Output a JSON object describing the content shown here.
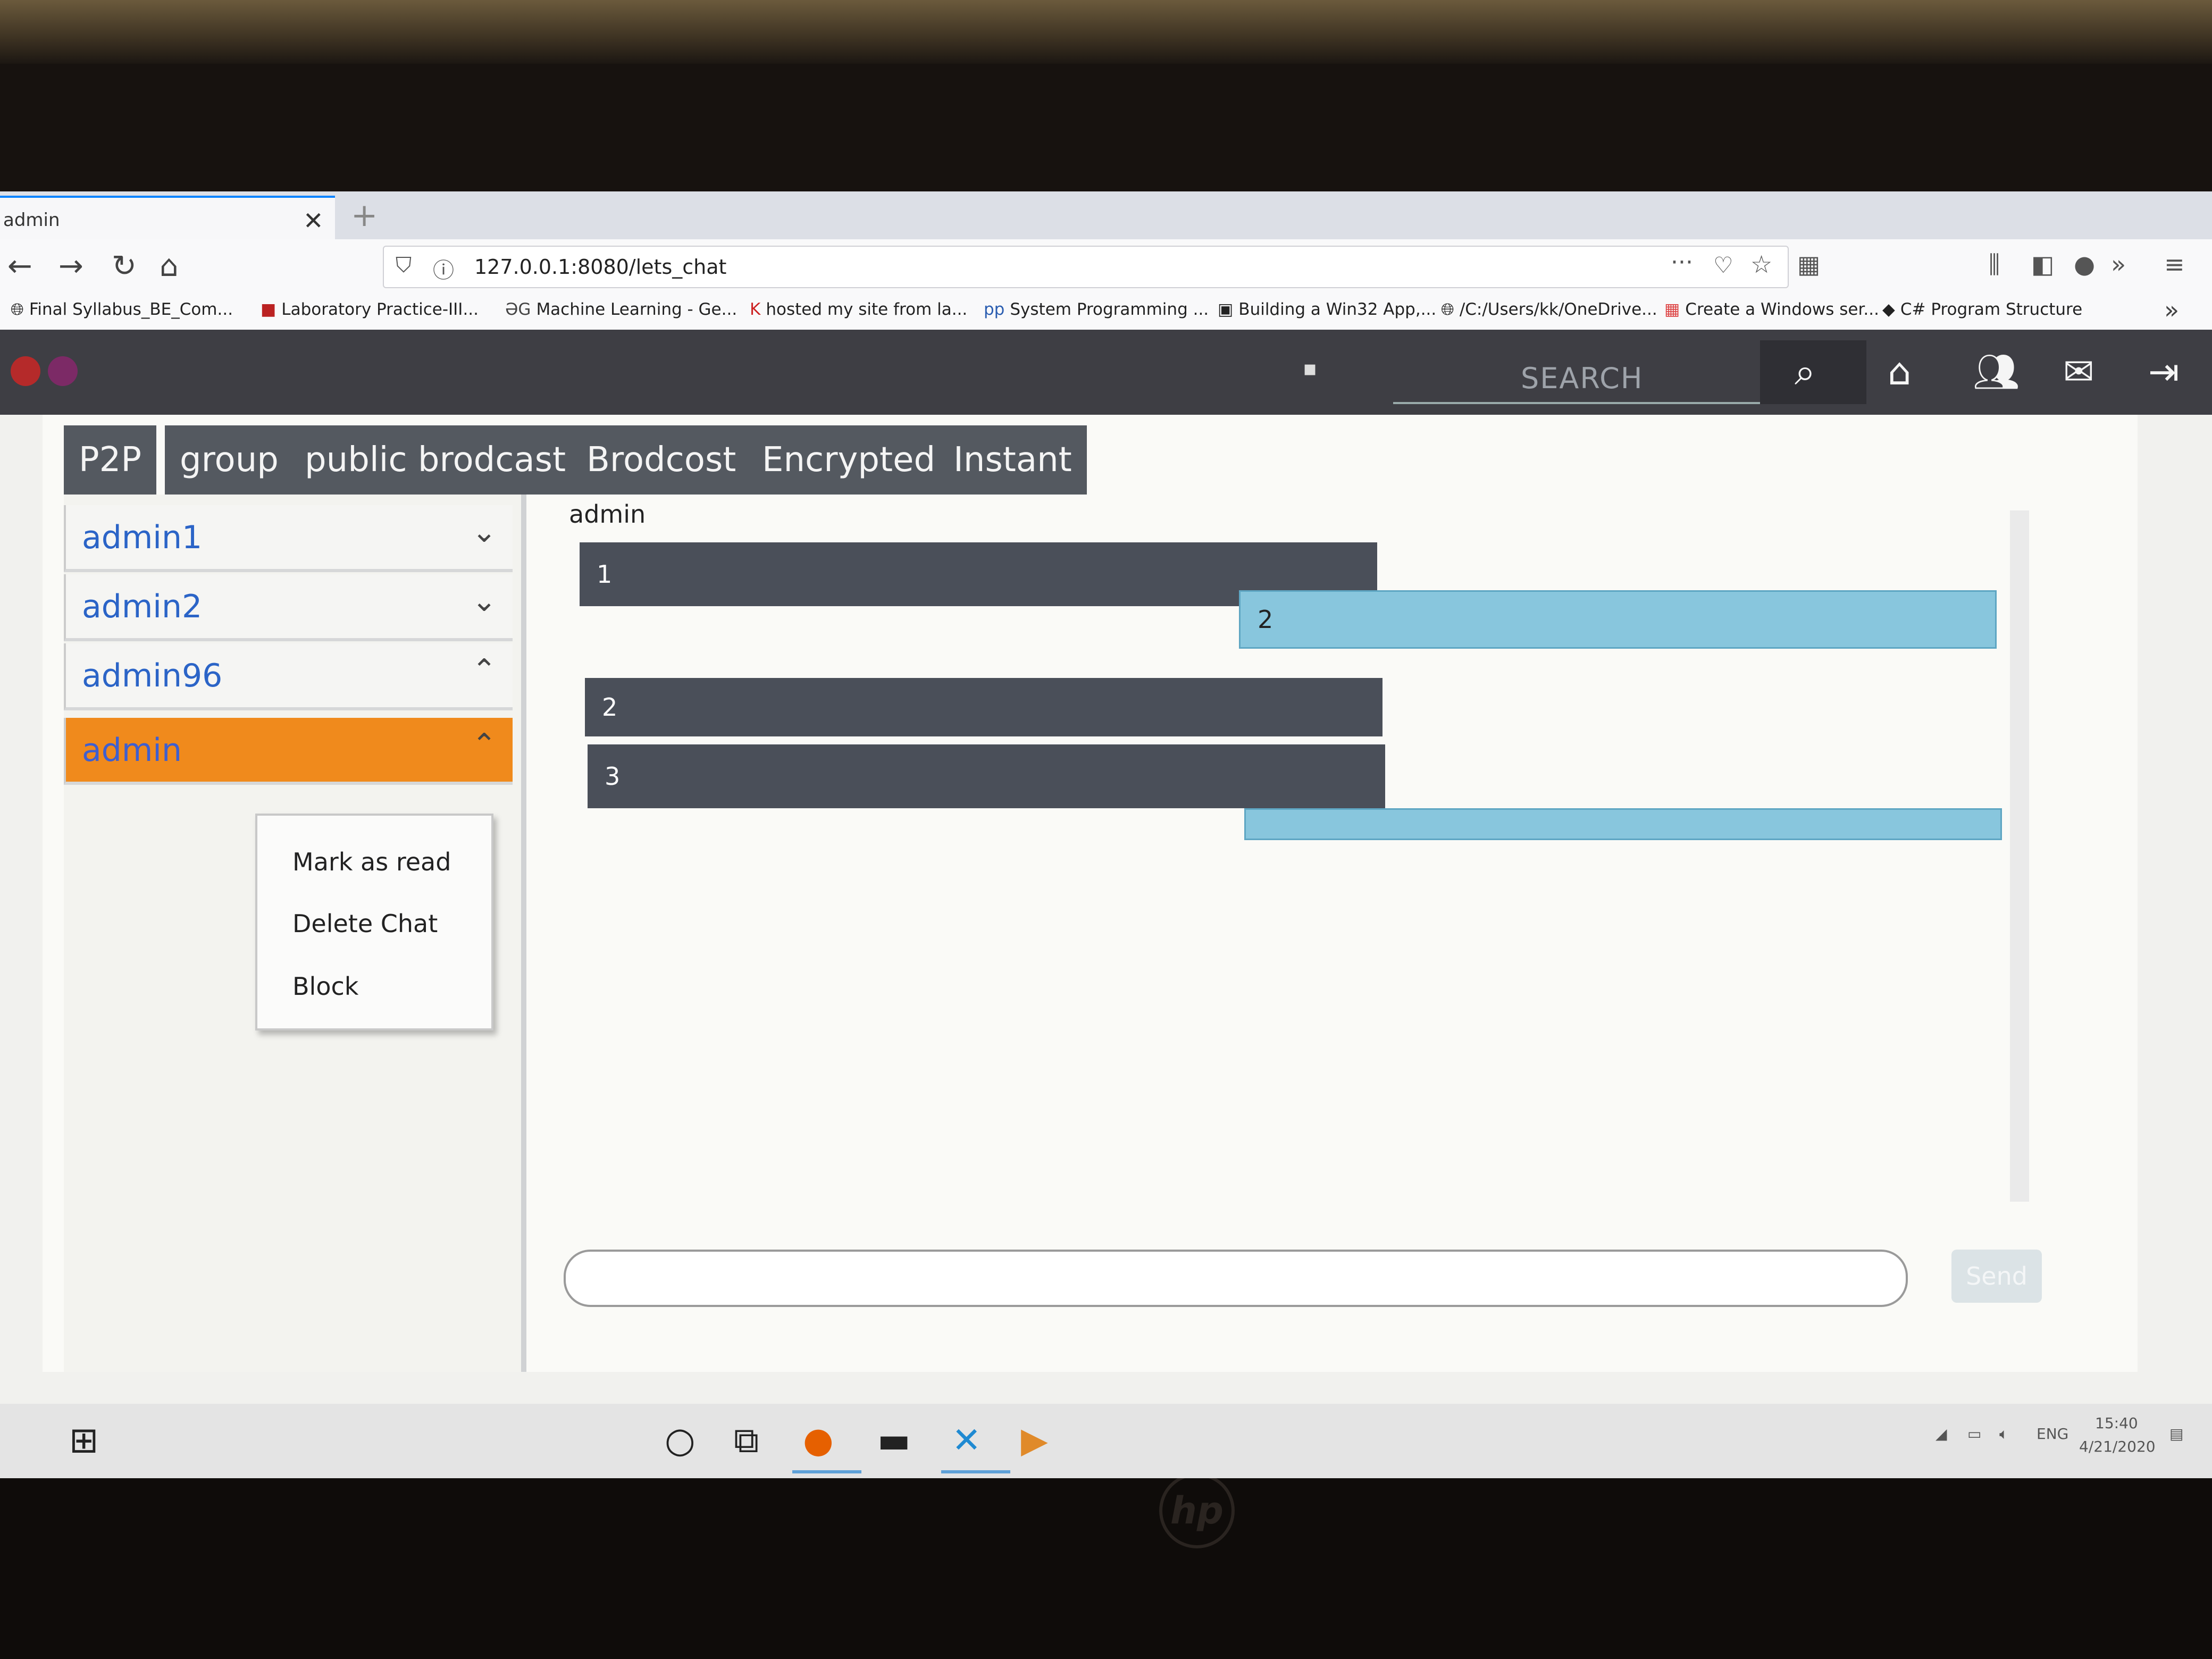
{
  "browser": {
    "tab_title": "admin",
    "tab_close": "✕",
    "new_tab": "+",
    "url": "127.0.0.1:8080/lets_chat",
    "bookmarks": [
      "Final Syllabus_BE_Com...",
      "Laboratory Practice-III...",
      "Machine Learning - Ge...",
      "hosted my site from la...",
      "System Programming ...",
      "Building a Win32 App,...",
      "/C:/Users/kk/OneDrive...",
      "Create a Windows ser...",
      "C# Program Structure"
    ]
  },
  "header": {
    "search_placeholder": "SEARCH"
  },
  "tabs": [
    {
      "label": "P2P"
    },
    {
      "label": "group"
    },
    {
      "label": "public brodcast"
    },
    {
      "label": "Brodcost"
    },
    {
      "label": "Encrypted"
    },
    {
      "label": "Instant"
    }
  ],
  "contacts": [
    {
      "name": "admin1",
      "chevron": "⌄"
    },
    {
      "name": "admin2",
      "chevron": "⌄"
    },
    {
      "name": "admin96",
      "chevron": "⌃"
    },
    {
      "name": "admin",
      "chevron": "⌃"
    }
  ],
  "context_menu": {
    "items": [
      "Mark as read",
      "Delete Chat",
      "Block"
    ]
  },
  "chat": {
    "title": "admin",
    "messages": [
      {
        "text": "1",
        "direction": "out"
      },
      {
        "text": "2",
        "direction": "in"
      },
      {
        "text": "2",
        "direction": "out"
      },
      {
        "text": "3",
        "direction": "out"
      },
      {
        "text": "",
        "direction": "in"
      }
    ],
    "send_label": "Send"
  },
  "taskbar": {
    "lang": "ENG",
    "time": "15:40",
    "date": "4/21/2020"
  },
  "brand": "hp",
  "colors": {
    "active_contact": "#f08a1c",
    "outgoing_message": "#4a4f59",
    "incoming_message": "#88c6dd",
    "header_bg": "#3e3e44",
    "tab_bg": "#545960"
  }
}
